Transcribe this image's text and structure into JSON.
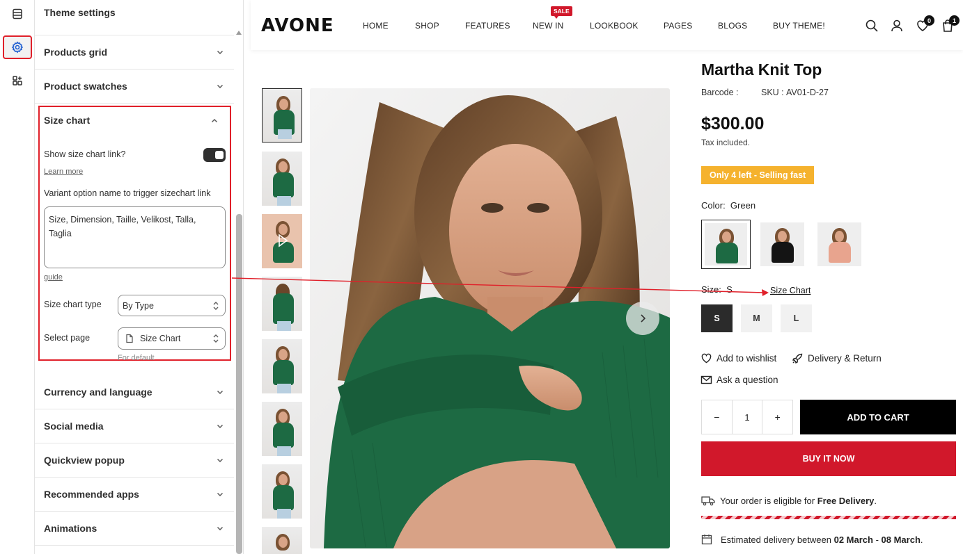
{
  "editor": {
    "panel_title": "Theme settings",
    "sections_top": [
      {
        "label": "Products grid"
      },
      {
        "label": "Product swatches"
      }
    ],
    "size_chart": {
      "title": "Size chart",
      "show_link_label": "Show size chart link?",
      "show_link_on": true,
      "learn_more": "Learn more",
      "variant_label": "Variant option name to trigger sizechart link",
      "variant_value": "Size, Dimension, Taille, Velikost, Talla, Taglia",
      "guide": "guide",
      "type_label": "Size chart type",
      "type_value": "By Type",
      "page_label": "Select page",
      "page_value": "Size Chart",
      "for_default": "For default"
    },
    "sections_bottom": [
      {
        "label": "Currency and language"
      },
      {
        "label": "Social media"
      },
      {
        "label": "Quickview popup"
      },
      {
        "label": "Recommended apps"
      },
      {
        "label": "Animations"
      }
    ]
  },
  "store": {
    "logo": "AVONE",
    "nav": [
      "HOME",
      "SHOP",
      "FEATURES",
      "NEW IN",
      "LOOKBOOK",
      "PAGES",
      "BLOGS",
      "BUY THEME!"
    ],
    "sale_badge": "SALE",
    "wishlist_count": "0",
    "cart_count": "1",
    "product": {
      "title": "Martha Knit Top",
      "barcode_label": "Barcode :",
      "sku_label": "SKU :",
      "sku": "AV01-D-27",
      "price": "$300.00",
      "tax_note": "Tax included.",
      "stock_badge": "Only 4 left - Selling fast",
      "color_label": "Color:",
      "color_value": "Green",
      "colors": [
        "#1d6a43",
        "#141414",
        "#e8a48e"
      ],
      "size_label": "Size:",
      "size_value": "S",
      "size_chart_link": "Size Chart",
      "sizes": [
        "S",
        "M",
        "L"
      ],
      "wishlist": "Add to wishlist",
      "delivery_return": "Delivery & Return",
      "ask_question": "Ask a question",
      "quantity": "1",
      "qty_minus": "−",
      "qty_plus": "+",
      "add_to_cart": "ADD TO CART",
      "buy_now": "BUY IT NOW",
      "free_delivery_prefix": "Your order is eligible for ",
      "free_delivery_bold": "Free Delivery",
      "free_delivery_suffix": ".",
      "est_prefix": "Estimated delivery between ",
      "est_from": "02 March",
      "est_sep": " - ",
      "est_to": "08 March",
      "est_suffix": "."
    }
  },
  "colors": {
    "accent_red": "#e0202a",
    "buy_red": "#d1182b",
    "stock_yellow": "#f5b22e",
    "sweater_green": "#1d6a43"
  }
}
